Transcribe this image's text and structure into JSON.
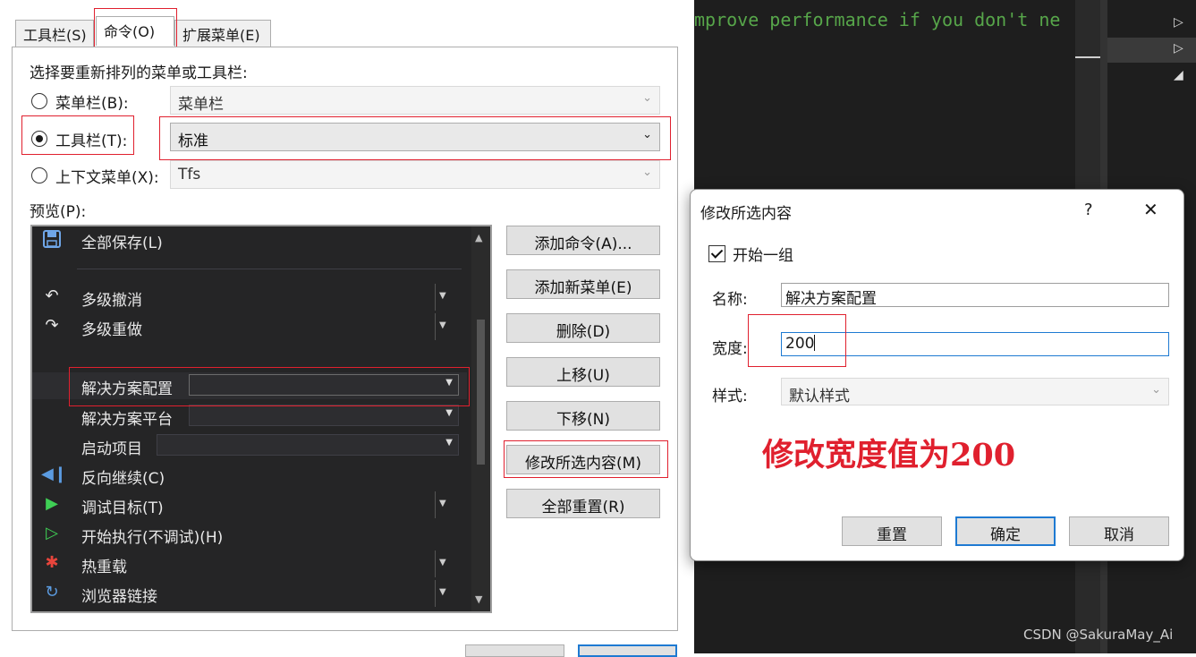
{
  "tabs": [
    {
      "label": "工具栏(S)"
    },
    {
      "label": "命令(O)"
    },
    {
      "label": "扩展菜单(E)"
    }
  ],
  "section_label": "选择要重新排列的菜单或工具栏:",
  "options": {
    "menubar": {
      "label": "菜单栏(B):",
      "value": "菜单栏"
    },
    "toolbar": {
      "label": "工具栏(T):",
      "value": "标准"
    },
    "context": {
      "label": "上下文菜单(X):",
      "value": "Tfs"
    }
  },
  "preview_label": "预览(P):",
  "preview_items": {
    "save_all": "全部保存(L)",
    "undo": "多级撤消",
    "redo": "多级重做",
    "solution_config": "解决方案配置",
    "solution_platform": "解决方案平台",
    "startup_project": "启动项目",
    "step_back": "反向继续(C)",
    "debug_target": "调试目标(T)",
    "start_without_debug": "开始执行(不调试)(H)",
    "hot_reload": "热重载",
    "browser_link": "浏览器链接"
  },
  "buttons": {
    "add_command": "添加命令(A)...",
    "add_menu": "添加新菜单(E)",
    "delete": "删除(D)",
    "move_up": "上移(U)",
    "move_down": "下移(N)",
    "modify_selection": "修改所选内容(M)",
    "reset_all": "全部重置(R)"
  },
  "editor": {
    "code_text": "mprove performance if you don't ne"
  },
  "dialog": {
    "title": "修改所选内容",
    "help": "?",
    "close": "✕",
    "begin_group": "开始一组",
    "name_label": "名称:",
    "name_value": "解决方案配置",
    "width_label": "宽度:",
    "width_value": "200",
    "style_label": "样式:",
    "style_value": "默认样式",
    "annotation": "修改宽度值为200",
    "reset": "重置",
    "ok": "确定",
    "cancel": "取消"
  },
  "watermark": "CSDN @SakuraMay_Ai",
  "colors": {
    "highlight_red": "#e0202e",
    "annotation_red": "#e0202e",
    "focus_blue": "#1e7ad2",
    "code_green": "#57a64a"
  }
}
